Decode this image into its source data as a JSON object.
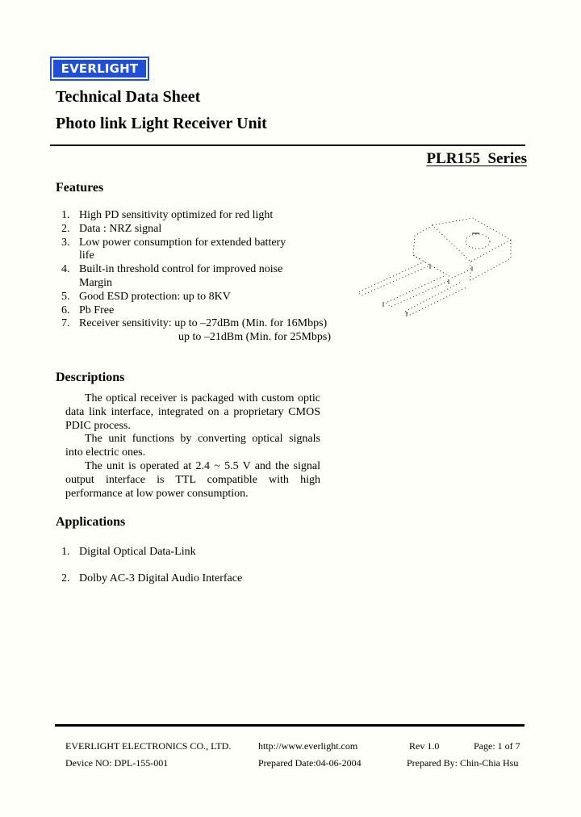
{
  "header": {
    "logo_text": "EVERLIGHT",
    "title": "Technical Data Sheet",
    "subtitle": "Photo link Light Receiver Unit",
    "series": "PLR155  Series"
  },
  "colors": {
    "brand_blue": "#1d4fd8",
    "background": "#fffffa"
  },
  "features": {
    "heading": "Features",
    "items": [
      {
        "num": "1.",
        "text": "High PD sensitivity optimized for red light"
      },
      {
        "num": "2.",
        "text": "Data : NRZ signal"
      },
      {
        "num": "3.",
        "text": "Low power consumption for extended battery",
        "continuation": "life"
      },
      {
        "num": "4.",
        "text": "Built-in threshold control for improved noise",
        "continuation": "Margin"
      },
      {
        "num": "5.",
        "text": "Good ESD protection: up to 8KV"
      },
      {
        "num": "6.",
        "text": "Pb Free"
      },
      {
        "num": "7.",
        "text": "Receiver sensitivity: up to –27dBm (Min. for 16Mbps)",
        "continuation": "up to –21dBm (Min. for 25Mbps)"
      }
    ]
  },
  "product_image": {
    "icon": "component-sketch-icon",
    "description": "Isometric dotted line drawing of receiver package with three leads"
  },
  "descriptions": {
    "heading": "Descriptions",
    "paragraphs": [
      "The optical receiver is packaged with custom optic data link interface, integrated on a proprietary CMOS PDIC process.",
      "The unit functions by converting optical signals into electric ones.",
      "The unit is operated at 2.4 ~ 5.5 V and the signal output interface is TTL compatible with high performance at low power consumption."
    ]
  },
  "applications": {
    "heading": "Applications",
    "items": [
      {
        "num": "1.",
        "text": "Digital Optical Data-Link"
      },
      {
        "num": "2.",
        "text": "Dolby AC-3 Digital Audio Interface"
      }
    ]
  },
  "footer": {
    "company": "EVERLIGHT ELECTRONICS CO., LTD.",
    "url": "http://www.everlight.com",
    "rev": "Rev 1.0",
    "page": "Page: 1 of 7",
    "device_no": "Device NO: DPL-155-001",
    "prepared_date": "Prepared Date:04-06-2004",
    "prepared_by": "Prepared By: Chin-Chia Hsu"
  }
}
